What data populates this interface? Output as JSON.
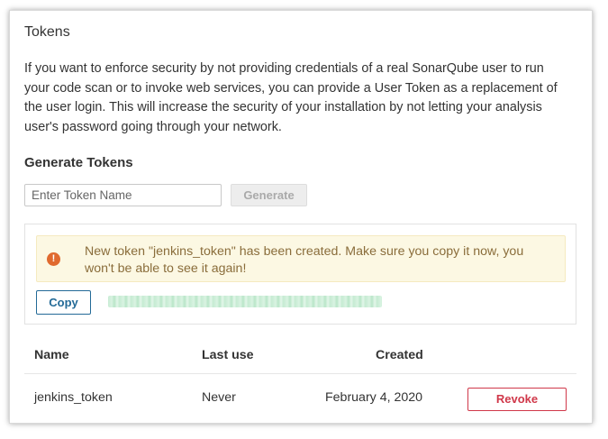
{
  "section": {
    "title": "Tokens",
    "description": "If you want to enforce security by not providing credentials of a real SonarQube user to run your code scan or to invoke web services, you can provide a User Token as a replacement of the user login. This will increase the security of your installation by not letting your analysis user's password going through your network."
  },
  "generate": {
    "heading": "Generate Tokens",
    "input_placeholder": "Enter Token Name",
    "input_value": "",
    "button_label": "Generate"
  },
  "new_token": {
    "alert_text": "New token \"jenkins_token\" has been created. Make sure you copy it now, you won't be able to see it again!",
    "alert_icon": "exclamation-circle-icon",
    "copy_label": "Copy",
    "token_value": "obscured-token-value"
  },
  "table": {
    "headers": {
      "name": "Name",
      "last_use": "Last use",
      "created": "Created"
    },
    "rows": [
      {
        "name": "jenkins_token",
        "last_use": "Never",
        "created": "February 4, 2020",
        "action": "Revoke"
      }
    ]
  },
  "colors": {
    "alert_bg": "#fcf8e3",
    "alert_text": "#8a6d3b",
    "alert_icon": "#e06a2f",
    "copy_button": "#236a97",
    "revoke_button": "#d0384a"
  }
}
